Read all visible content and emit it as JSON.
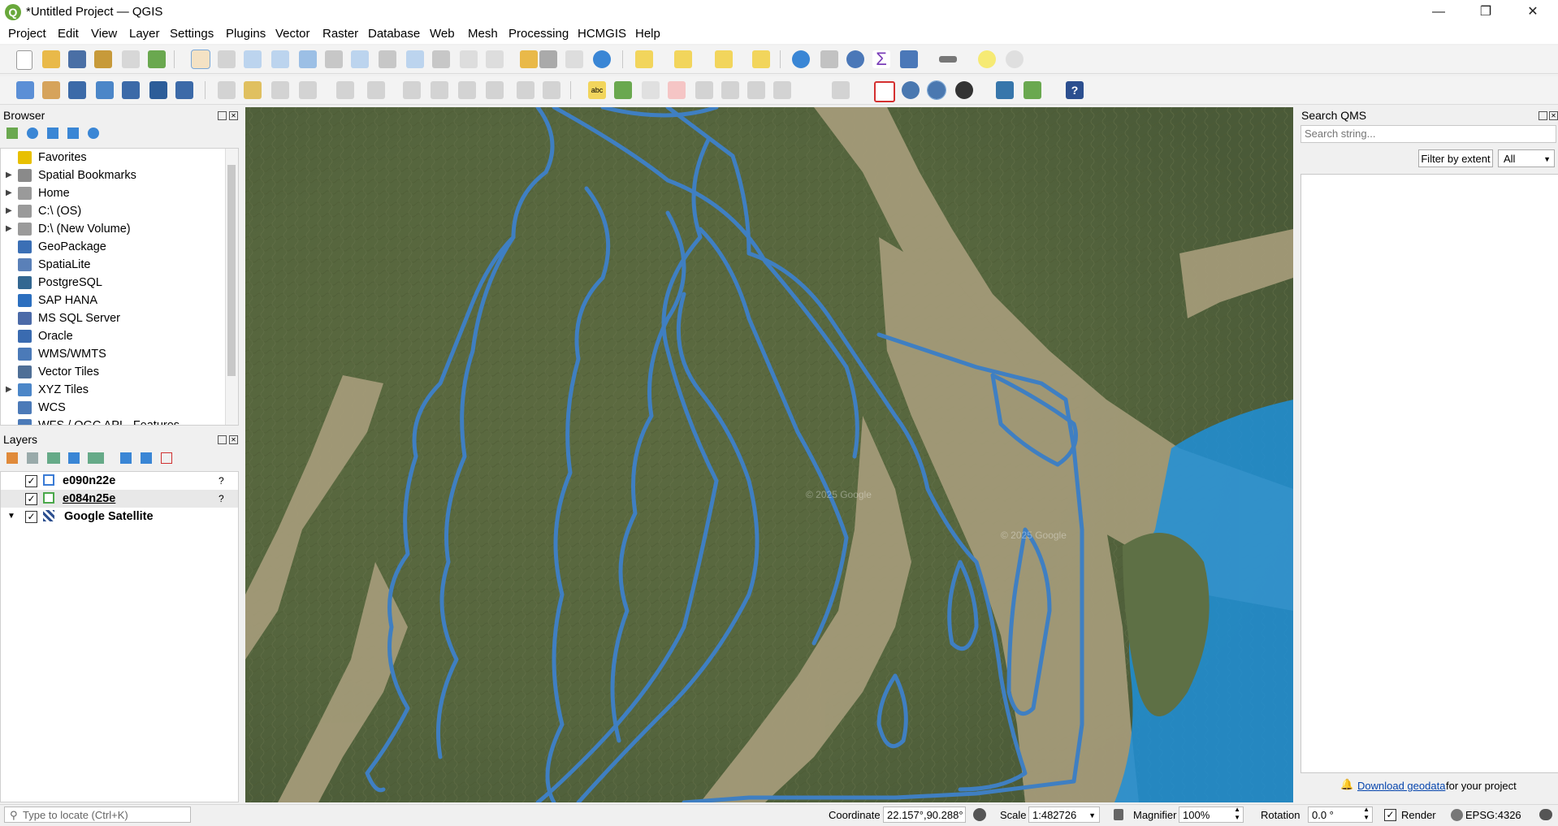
{
  "window": {
    "title": "*Untitled Project — QGIS",
    "minimize": "—",
    "restore": "❐",
    "close": "✕"
  },
  "menu": [
    "Project",
    "Edit",
    "View",
    "Layer",
    "Settings",
    "Plugins",
    "Vector",
    "Raster",
    "Database",
    "Web",
    "Mesh",
    "Processing",
    "HCMGIS",
    "Help"
  ],
  "toolbar": {
    "label_icon_text": "abc"
  },
  "browser": {
    "title": "Browser",
    "items": [
      {
        "label": "Favorites",
        "icon": "star-icon",
        "color": "#e8c000",
        "expandable": false
      },
      {
        "label": "Spatial Bookmarks",
        "icon": "bookmark-icon",
        "color": "#8a8a8a",
        "expandable": true
      },
      {
        "label": "Home",
        "icon": "home-icon",
        "color": "#9a9a9a",
        "expandable": true
      },
      {
        "label": "C:\\ (OS)",
        "icon": "folder-icon",
        "color": "#9a9a9a",
        "expandable": true
      },
      {
        "label": "D:\\ (New Volume)",
        "icon": "folder-icon",
        "color": "#9a9a9a",
        "expandable": true
      },
      {
        "label": "GeoPackage",
        "icon": "geopackage-icon",
        "color": "#3b6fb5",
        "expandable": false
      },
      {
        "label": "SpatiaLite",
        "icon": "feather-icon",
        "color": "#5a80b8",
        "expandable": false
      },
      {
        "label": "PostgreSQL",
        "icon": "elephant-icon",
        "color": "#336791",
        "expandable": false
      },
      {
        "label": "SAP HANA",
        "icon": "grid-dots-icon",
        "color": "#2c6fbf",
        "expandable": false
      },
      {
        "label": "MS SQL Server",
        "icon": "mssql-icon",
        "color": "#4b6aa8",
        "expandable": false
      },
      {
        "label": "Oracle",
        "icon": "oracle-icon",
        "color": "#3a6bb0",
        "expandable": false
      },
      {
        "label": "WMS/WMTS",
        "icon": "globe-icon",
        "color": "#4b7ab8",
        "expandable": false
      },
      {
        "label": "Vector Tiles",
        "icon": "vector-tiles-icon",
        "color": "#4f6f96",
        "expandable": false
      },
      {
        "label": "XYZ Tiles",
        "icon": "xyz-tiles-icon",
        "color": "#4b86c8",
        "expandable": true
      },
      {
        "label": "WCS",
        "icon": "globe-icon",
        "color": "#4b7ab8",
        "expandable": false
      },
      {
        "label": "WFS / OGC API - Features",
        "icon": "globe-icon",
        "color": "#4b7ab8",
        "expandable": false
      }
    ]
  },
  "layers": {
    "title": "Layers",
    "items": [
      {
        "name": "e090n22e",
        "checked": true,
        "swatch": "#3a7bd5",
        "warning": "?"
      },
      {
        "name": "e084n25e",
        "checked": true,
        "swatch": "#4aa84a",
        "warning": "?"
      },
      {
        "name": "Google Satellite",
        "checked": true,
        "swatch": "raster",
        "expanded": true
      }
    ]
  },
  "qms": {
    "title": "Search QMS",
    "search_placeholder": "Search string...",
    "filter_button": "Filter by extent",
    "filter_select": "All",
    "bell": "🔔",
    "download_link": "Download geodata",
    "download_suffix": " for your project"
  },
  "statusbar": {
    "locate_placeholder": "Type to locate (Ctrl+K)",
    "coordinate_label": "Coordinate",
    "coordinate_value": "22.157°,90.288°",
    "scale_label": "Scale",
    "scale_value": "1:482726",
    "magnifier_label": "Magnifier",
    "magnifier_value": "100%",
    "rotation_label": "Rotation",
    "rotation_value": "0.0 °",
    "render_label": "Render",
    "render_checked": true,
    "crs": "EPSG:4326"
  },
  "map": {
    "watermark": "© 2025 Google",
    "line_color": "#3f7fc2",
    "sea_color": "#1f8fd8"
  }
}
